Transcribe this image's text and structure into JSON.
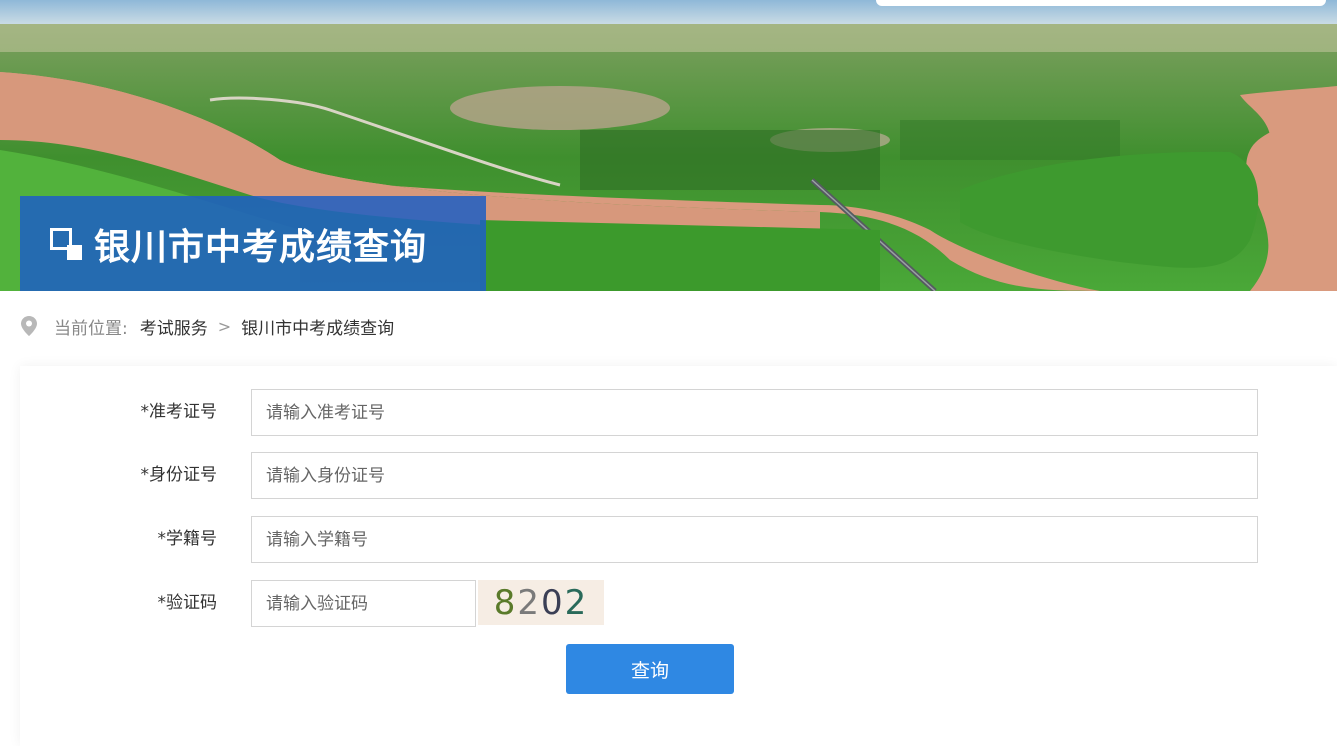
{
  "banner": {
    "title": "银川市中考成绩查询"
  },
  "breadcrumb": {
    "prefix": "当前位置:",
    "link": "考试服务",
    "separator": ">",
    "current": "银川市中考成绩查询"
  },
  "form": {
    "fields": [
      {
        "label": "*准考证号",
        "placeholder": "请输入准考证号",
        "value": ""
      },
      {
        "label": "*身份证号",
        "placeholder": "请输入身份证号",
        "value": ""
      },
      {
        "label": "*学籍号",
        "placeholder": "请输入学籍号",
        "value": ""
      },
      {
        "label": "*验证码",
        "placeholder": "请输入验证码",
        "value": ""
      }
    ],
    "captcha": [
      "8",
      "2",
      "0",
      "2"
    ],
    "submit_label": "查询"
  },
  "colors": {
    "title_box": "#1e60c4",
    "button": "#2f88e3",
    "captcha_bg": "#f6ede4"
  }
}
